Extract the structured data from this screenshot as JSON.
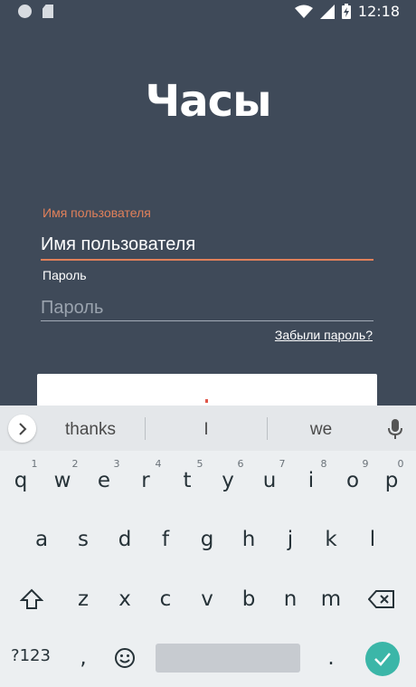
{
  "status_bar": {
    "time": "12:18",
    "icons": [
      "circle-notification-icon",
      "sd-card-icon",
      "wifi-icon",
      "signal-icon",
      "battery-charging-icon"
    ]
  },
  "app": {
    "logo": "Часы",
    "username_label": "Имя пользователя",
    "username_value": "Имя пользователя",
    "password_label": "Пароль",
    "password_placeholder": "Пароль",
    "forgot_link": "Забыли пароль?",
    "accent_color": "#e0805a",
    "background_color": "#3f4a59"
  },
  "keyboard": {
    "suggestions": [
      "thanks",
      "I",
      "we"
    ],
    "row1": [
      {
        "k": "q",
        "h": "1"
      },
      {
        "k": "w",
        "h": "2"
      },
      {
        "k": "e",
        "h": "3"
      },
      {
        "k": "r",
        "h": "4"
      },
      {
        "k": "t",
        "h": "5"
      },
      {
        "k": "y",
        "h": "6"
      },
      {
        "k": "u",
        "h": "7"
      },
      {
        "k": "i",
        "h": "8"
      },
      {
        "k": "o",
        "h": "9"
      },
      {
        "k": "p",
        "h": "0"
      }
    ],
    "row2": [
      "a",
      "s",
      "d",
      "f",
      "g",
      "h",
      "j",
      "k",
      "l"
    ],
    "row3": [
      "z",
      "x",
      "c",
      "v",
      "b",
      "n",
      "m"
    ],
    "symbols_key": "?123",
    "comma_key": ",",
    "period_key": ".",
    "enter_color": "#3bb6a8"
  }
}
